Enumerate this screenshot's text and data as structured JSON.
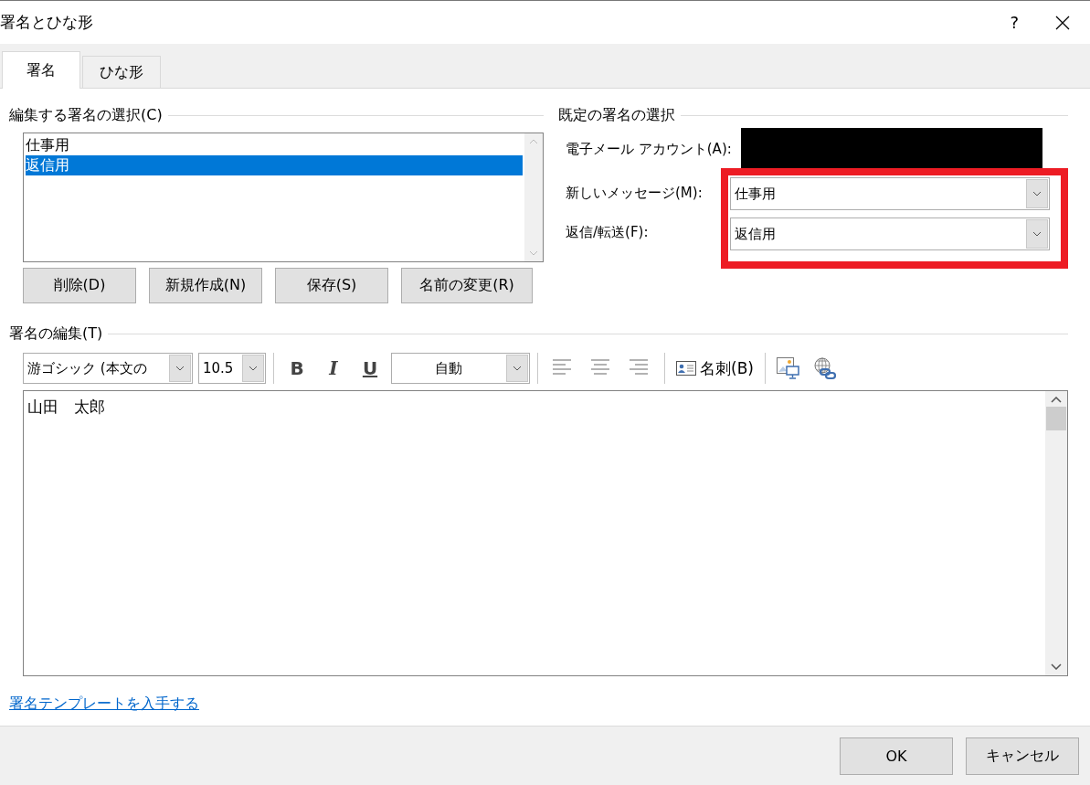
{
  "window": {
    "title": "署名とひな形",
    "help": "?"
  },
  "tabs": [
    {
      "label": "署名",
      "selected": true
    },
    {
      "label": "ひな形",
      "selected": false
    }
  ],
  "edit_section": {
    "heading": "編集する署名の選択(C)",
    "signatures": [
      {
        "name": "仕事用",
        "selected": false
      },
      {
        "name": "返信用",
        "selected": true
      }
    ],
    "buttons": [
      "削除(D)",
      "新規作成(N)",
      "保存(S)",
      "名前の変更(R)"
    ]
  },
  "default_section": {
    "heading": "既定の署名の選択",
    "fields": [
      {
        "kind": "redacted",
        "label": "電子メール アカウント(A):",
        "highlighted": false
      },
      {
        "kind": "dropdown",
        "label": "新しいメッセージ(M):",
        "value": "仕事用",
        "highlighted": true
      },
      {
        "kind": "dropdown",
        "label": "返信/転送(F):",
        "value": "返信用",
        "highlighted": true
      }
    ]
  },
  "editor": {
    "heading": "署名の編集(T)",
    "toolbar": {
      "font": "游ゴシック (本文の",
      "size": "10.5",
      "format_buttons": [
        "B",
        "I",
        "U"
      ],
      "fill_option": "自動",
      "business_card": "名刺(B)"
    },
    "text": "山田　太郎"
  },
  "template_link": "署名テンプレートを入手する",
  "footer_buttons": [
    "OK",
    "キャンセル"
  ]
}
